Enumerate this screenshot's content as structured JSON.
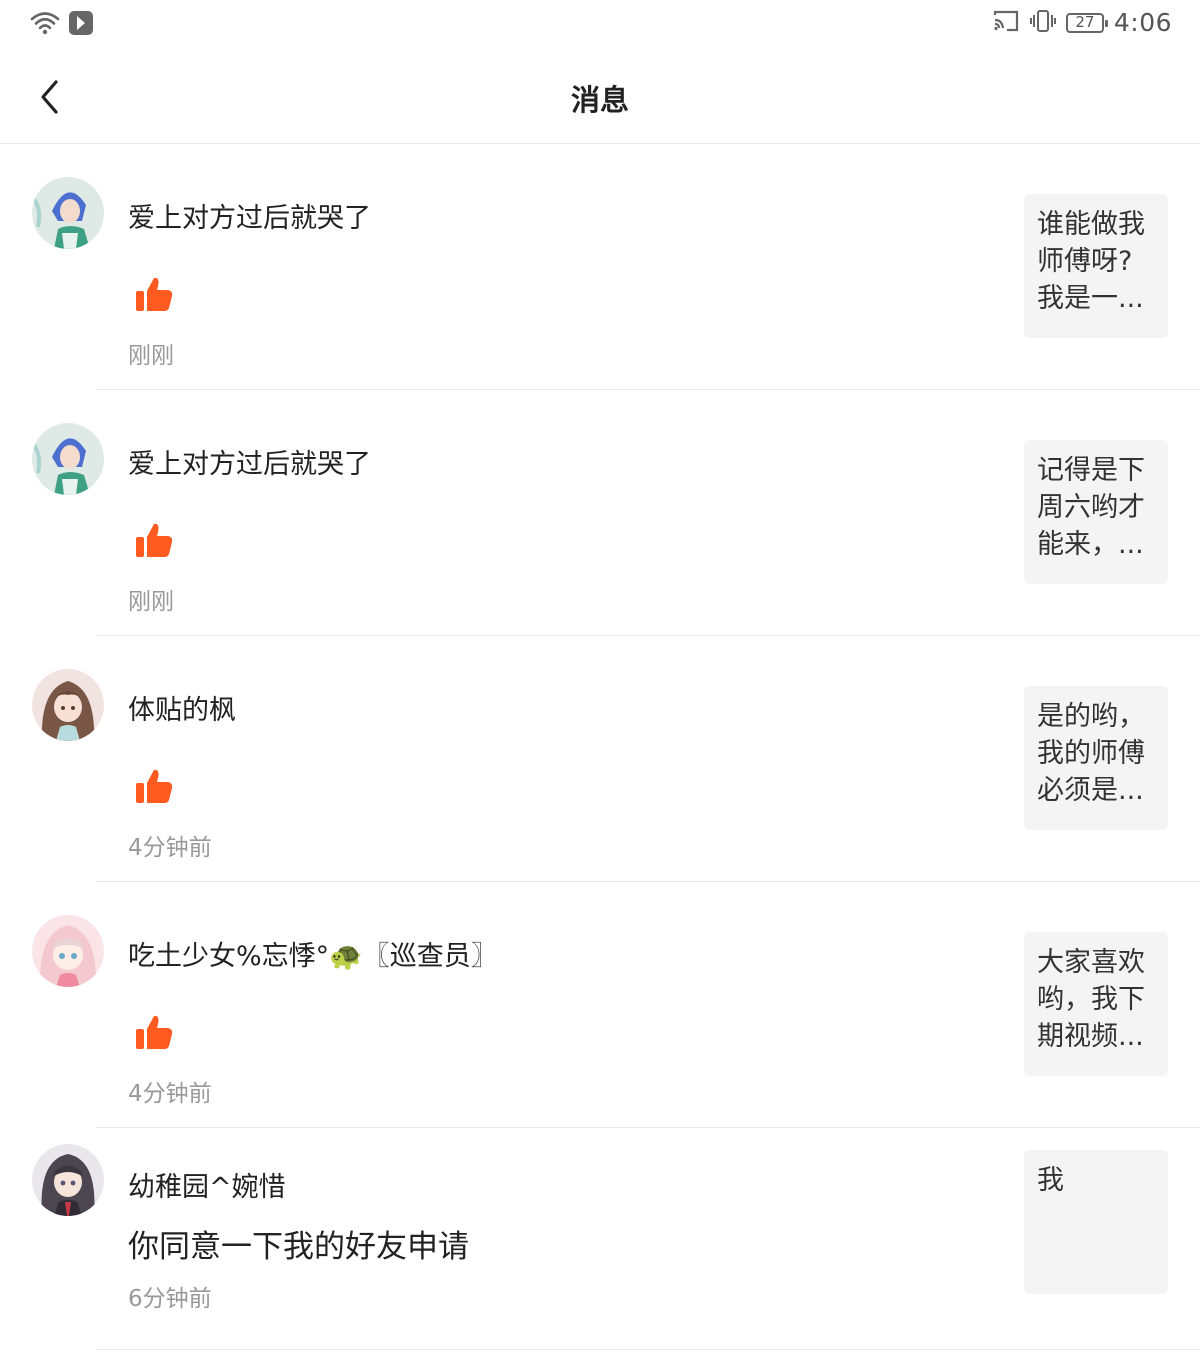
{
  "status_bar": {
    "time": "4:06",
    "battery": "27",
    "icons_left": [
      "wifi-icon",
      "app-notification-icon"
    ],
    "icons_right": [
      "cast-icon",
      "vibrate-icon",
      "battery-icon"
    ]
  },
  "header": {
    "title": "消息",
    "back_icon": "chevron-left-icon"
  },
  "colors": {
    "like": "#ff5a1f",
    "time_text": "#999999",
    "preview_bg": "#f4f4f4"
  },
  "messages": [
    {
      "username": "爱上对方过后就哭了",
      "action_icon": "thumbs-up-icon",
      "time": "刚刚",
      "preview": "谁能做我师傅呀?我是一..."
    },
    {
      "username": "爱上对方过后就哭了",
      "action_icon": "thumbs-up-icon",
      "time": "刚刚",
      "preview": "记得是下周六哟才能来，..."
    },
    {
      "username": "体贴的枫",
      "action_icon": "thumbs-up-icon",
      "time": "4分钟前",
      "preview": "是的哟，我的师傅必须是..."
    },
    {
      "username": "吃土少女%忘悸°🐢〖巡查员〗",
      "action_icon": "thumbs-up-icon",
      "time": "4分钟前",
      "preview": "大家喜欢哟，我下期视频..."
    },
    {
      "username": "幼稚园^婉惜",
      "comment": "你同意一下我的好友申请",
      "time": "6分钟前",
      "preview": "我"
    }
  ]
}
